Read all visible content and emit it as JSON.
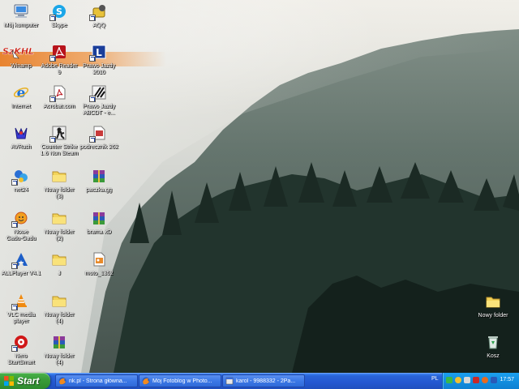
{
  "desktop": {
    "icons_left": [
      {
        "label": "Mój komputer",
        "icon": "my-computer-icon"
      },
      {
        "label": "Skype",
        "icon": "skype-icon"
      },
      {
        "label": "AQQ",
        "icon": "aqq-icon"
      },
      {
        "label": "Winamp",
        "icon": "winamp-icon"
      },
      {
        "label": "Adobe Reader\n9",
        "icon": "adobe-reader-icon"
      },
      {
        "label": "Prawo Jazdy\n2010",
        "icon": "prawo-jazdy-icon"
      },
      {
        "label": "Internet",
        "icon": "internet-explorer-icon"
      },
      {
        "label": "Acrobat.com",
        "icon": "acrobat-icon"
      },
      {
        "label": "Prawo Jazdy\nABCDT - e...",
        "icon": "prawo-jazdy-abcdt-icon"
      },
      {
        "label": "AVRush",
        "icon": "avrush-icon"
      },
      {
        "label": "Counter Strike\n1.6 Non Steam",
        "icon": "counter-strike-icon"
      },
      {
        "label": "podrecznik 262",
        "icon": "document-icon"
      },
      {
        "label": "net24",
        "icon": "net24-icon"
      },
      {
        "label": "Nowy folder\n(3)",
        "icon": "folder-icon"
      },
      {
        "label": "paczka.gg",
        "icon": "winrar-archive-icon"
      },
      {
        "label": "Nowe\nGadu-Gadu",
        "icon": "gadu-gadu-icon"
      },
      {
        "label": "Nowy folder\n(2)",
        "icon": "folder-icon"
      },
      {
        "label": "brama xD",
        "icon": "winrar-archive-icon"
      },
      {
        "label": "ALLPlayer V4.1",
        "icon": "allplayer-icon"
      },
      {
        "label": "J",
        "icon": "folder-icon"
      },
      {
        "label": "moto_1352",
        "icon": "image-file-icon"
      },
      {
        "label": "VLC media\nplayer",
        "icon": "vlc-icon"
      },
      {
        "label": "Nowy folder\n(4)",
        "icon": "folder-icon"
      },
      {
        "label": "Nero\nStartSmart",
        "icon": "nero-icon"
      },
      {
        "label": "Nowy folder\n(4)",
        "icon": "winrar-archive-icon"
      }
    ],
    "icons_right": [
      {
        "label": "Nowy folder",
        "icon": "folder-icon"
      },
      {
        "label": "Kosz",
        "icon": "recycle-bin-icon"
      }
    ]
  },
  "taskbar": {
    "start_label": "Start",
    "tasks": [
      {
        "label": "nk.pl - Strona główna...",
        "icon": "firefox-icon"
      },
      {
        "label": "Mój Fotoblog w Photo...",
        "icon": "firefox-icon"
      },
      {
        "label": "karol - 9988332 - 2Pa...",
        "icon": "chat-window-icon"
      }
    ],
    "tray": {
      "language": "PL",
      "clock": "17:57"
    }
  },
  "colors": {
    "taskbar_blue": "#2357d0",
    "start_green": "#3a9d3a",
    "tray_blue": "#138fe0",
    "winamp_orange": "#e87e26"
  }
}
